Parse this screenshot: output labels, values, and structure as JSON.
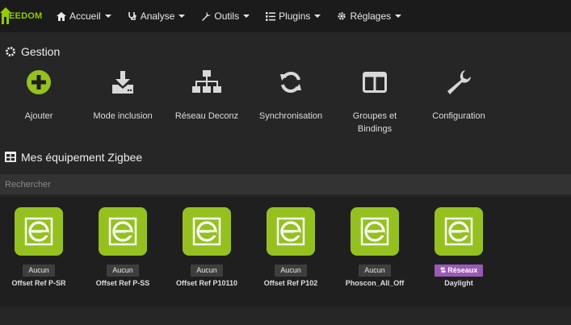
{
  "brand": {
    "name": "EEDOM",
    "color": "#94ca02"
  },
  "navbar": {
    "items": [
      {
        "label": "Accueil",
        "icon": "home-icon"
      },
      {
        "label": "Analyse",
        "icon": "stethoscope-icon"
      },
      {
        "label": "Outils",
        "icon": "wrench-icon"
      },
      {
        "label": "Plugins",
        "icon": "tasks-icon"
      },
      {
        "label": "Réglages",
        "icon": "cogs-icon"
      }
    ]
  },
  "gestion": {
    "title": "Gestion",
    "accent": "#94c11f",
    "items": [
      {
        "label": "Ajouter",
        "icon": "plus-circle-icon"
      },
      {
        "label": "Mode inclusion",
        "icon": "download-icon"
      },
      {
        "label": "Réseau Deconz",
        "icon": "sitemap-icon"
      },
      {
        "label": "Synchronisation",
        "icon": "sync-icon"
      },
      {
        "label": "Groupes et Bindings",
        "icon": "columns-icon"
      },
      {
        "label": "Configuration",
        "icon": "wrench-icon"
      }
    ]
  },
  "equipments": {
    "title": "Mes équipement Zigbee",
    "search_placeholder": "Rechercher",
    "items": [
      {
        "name": "Offset Ref P-SR",
        "badge": "Aucun"
      },
      {
        "name": "Offset Ref P-SS",
        "badge": "Aucun"
      },
      {
        "name": "Offset Ref P10110",
        "badge": "Aucun"
      },
      {
        "name": "Offset Ref P102",
        "badge": "Aucun"
      },
      {
        "name": "Phoscon_All_Off",
        "badge": "Aucun"
      },
      {
        "name": "Daylight",
        "badge": "Réseaux"
      }
    ]
  },
  "colors": {
    "tile": "#94c11f",
    "badge_default": "#3e3e3e",
    "badge_network": "#9b59b6"
  }
}
